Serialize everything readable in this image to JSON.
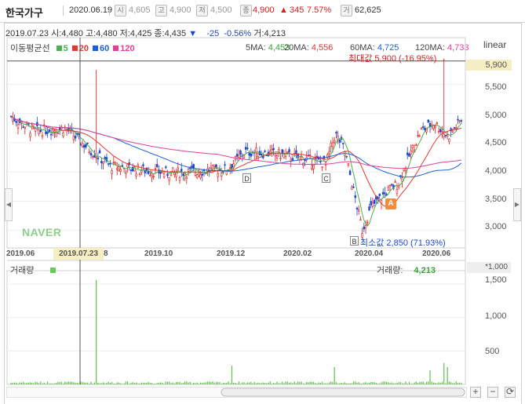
{
  "header": {
    "stock_name": "한국가구",
    "date": "2020.06.19",
    "open_icon": "시",
    "open": "4,605",
    "high_icon": "고",
    "high": "4,900",
    "low_icon": "저",
    "low": "4,500",
    "close_icon": "종",
    "close": "4,900",
    "change_arrow": "▲",
    "change": "345",
    "change_pct": "7.57%",
    "volume_icon": "거",
    "volume": "62,625"
  },
  "info_line": {
    "date": "2019.07.23",
    "open": "시:4,480",
    "high": "고:4,480",
    "low": "저:4,425",
    "close": "종:4,435",
    "arrow": "▼",
    "change": "-25",
    "change_pct": "-0.56%",
    "volume": "거:4,213"
  },
  "scale_mode": "linear",
  "legend": {
    "title": "이동평균선",
    "items": [
      {
        "label": "5",
        "color": "#4caf50"
      },
      {
        "label": "20",
        "color": "#e53935"
      },
      {
        "label": "60",
        "color": "#1e5fd8"
      },
      {
        "label": "120",
        "color": "#e0409a"
      }
    ]
  },
  "ma_values": [
    {
      "label": "5MA:",
      "value": "4,453",
      "color": "#3aa33a"
    },
    {
      "label": "20MA:",
      "value": "4,556",
      "color": "#e53935"
    },
    {
      "label": "60MA:",
      "value": "4,725",
      "color": "#1e5fd8"
    },
    {
      "label": "120MA:",
      "value": "4,733",
      "color": "#e0409a"
    }
  ],
  "annotations": {
    "max_label": "최대값 5,900 (-16.95%)",
    "min_label": "최소값 2,850 (71.93%)",
    "tag_a": "A",
    "tag_b": "B",
    "tag_c": "C",
    "tag_d": "D"
  },
  "watermark": "NAVER",
  "x_axis": {
    "highlight": "2019.07.23",
    "labels": [
      "2019.06",
      "8",
      "2019.10",
      "2019.12",
      "2020.02",
      "2020.04",
      "2020.06"
    ]
  },
  "y_axis": {
    "highlight": "5,900",
    "labels": [
      "5,500",
      "5,000",
      "4,500",
      "4,000",
      "3,500",
      "3,000"
    ]
  },
  "volume_panel": {
    "label": "거래량",
    "current_label": "거래량:",
    "current_value": "4,213",
    "unit": "*1,000",
    "y_labels": [
      "1,500",
      "1,000",
      "500"
    ]
  },
  "controls": {
    "zoom_in": "+",
    "zoom_out": "−",
    "reset": "⟳"
  },
  "chart_data": {
    "type": "candlestick",
    "price_range": [
      2700,
      6300
    ],
    "volume_range": [
      0,
      1700
    ],
    "max_price": 5900,
    "min_price": 2850,
    "dates_start": "2019.06",
    "dates_end": "2020.06.19",
    "volume_spike": 1560
  }
}
